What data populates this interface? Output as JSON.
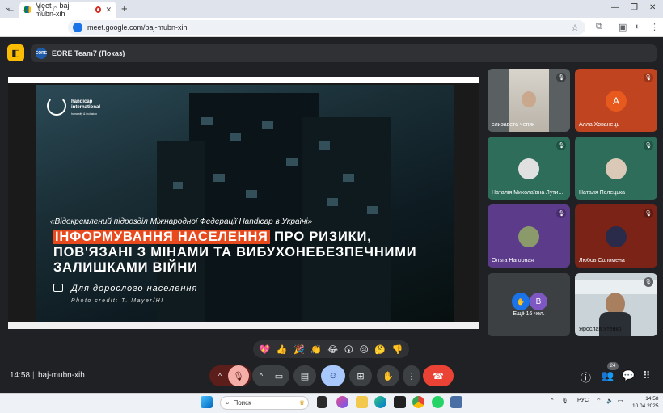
{
  "browser": {
    "tab_title": "Meet – baj-mubn-xih",
    "url": "meet.google.com/baj-mubn-xih"
  },
  "meeting": {
    "presenter_label": "EORE Team7 (Показ)",
    "presenter_logo": "EORE",
    "time": "14:58",
    "code": "baj-mubn-xih",
    "participant_count": "24"
  },
  "slide": {
    "logo_text_1": "handicap",
    "logo_text_2": "international",
    "logo_sub": "humanity & inclusion",
    "org": "«Відокремлений підрозділ Міжнародної Федерації Handicap в Україні»",
    "title_highlight": "ІНФОРМУВАННЯ НАСЕЛЕННЯ",
    "title_rest": " ПРО РИЗИКИ,",
    "title_line2": "ПОВ'ЯЗАНІ З МІНАМИ ТА ВИБУХОНЕБЕЗПЕЧНИМИ",
    "title_line3": "ЗАЛИШКАМИ ВІЙНИ",
    "audience": "Для дорослого населення",
    "photo_credit": "Photo credit: T. Mayer/HI"
  },
  "participants": [
    {
      "name": "єлизавета чепяк",
      "avatar": "",
      "mic": "muted"
    },
    {
      "name": "Алла Хованець",
      "avatar": "A",
      "mic": "muted"
    },
    {
      "name": "Наталія Миколаївна Лути...",
      "avatar": "",
      "mic": "muted"
    },
    {
      "name": "Наталя Пелецька",
      "avatar": "",
      "mic": "muted"
    },
    {
      "name": "Ольга Нагорная",
      "avatar": "",
      "mic": "muted"
    },
    {
      "name": "Любов Соломена",
      "avatar": "",
      "mic": "muted"
    },
    {
      "name": "Ещё 16 чел.",
      "avatar": "B",
      "mic": ""
    },
    {
      "name": "Ярослав Утенко",
      "avatar": "",
      "mic": "muted"
    }
  ],
  "reactions": [
    "💖",
    "👍",
    "🎉",
    "👏",
    "😂",
    "😮",
    "😢",
    "🤔",
    "👎"
  ],
  "taskbar": {
    "search_placeholder": "Поиск",
    "lang": "РУС",
    "time": "14:58",
    "date": "10.04.2025"
  },
  "colors": {
    "accent_yellow": "#fbbc04",
    "end_call": "#ea4335",
    "slide_highlight": "#e8491d"
  }
}
